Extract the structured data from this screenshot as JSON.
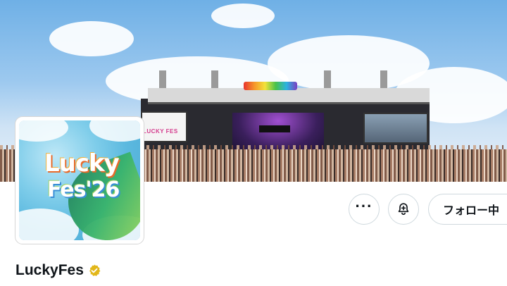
{
  "banner": {
    "description": "festival stage banner",
    "stage_sign_left": "LUCKY FES",
    "stage_sign_center": ""
  },
  "avatar": {
    "line1": "Lucky",
    "line2": "Fes'26"
  },
  "actions": {
    "more_icon": "more-icon",
    "notify_icon": "bell-plus-icon",
    "follow_label": "フォロー中"
  },
  "profile": {
    "display_name": "LuckyFes",
    "verified_badge": "gold-verified-badge",
    "verified_color": "#e2b719"
  },
  "colors": {
    "text": "#0f1419",
    "border": "#cfd9de"
  }
}
